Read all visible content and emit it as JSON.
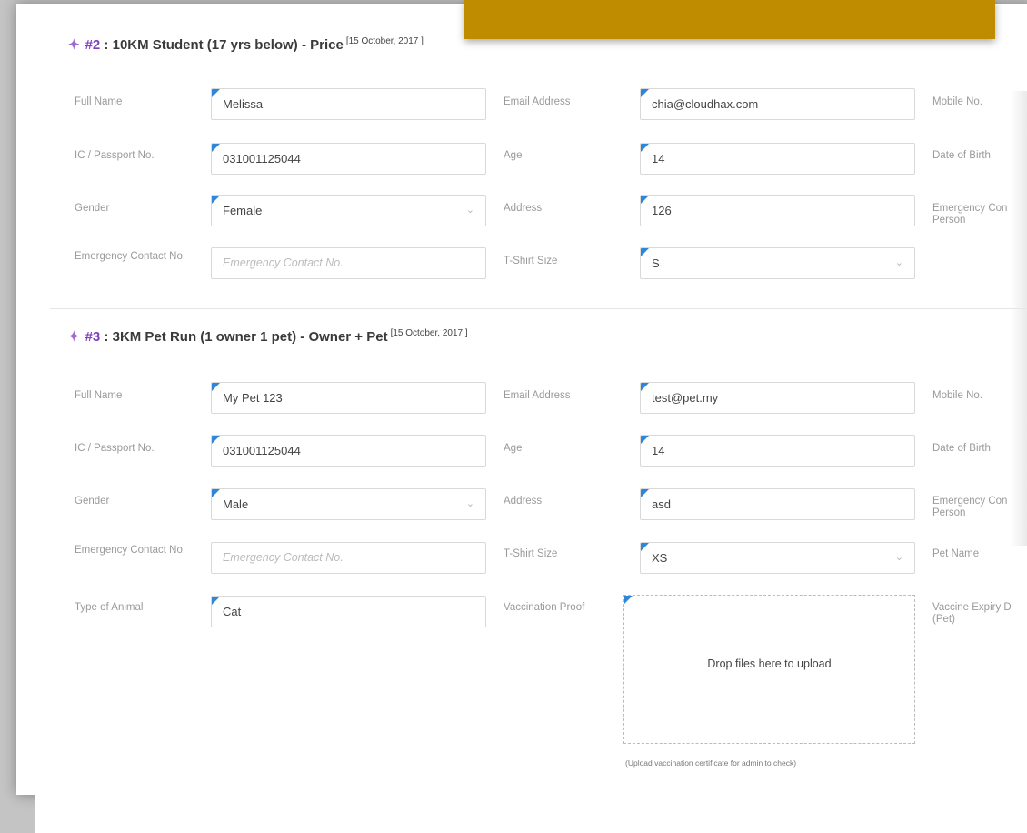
{
  "sections": [
    {
      "num": "#2",
      "title": " : 10KM Student (17 yrs below) - Price",
      "date": "[15 October, 2017 ]",
      "fields": {
        "full_name": {
          "label": "Full Name",
          "value": "Melissa"
        },
        "email": {
          "label": "Email Address",
          "value": "chia@cloudhax.com"
        },
        "mobile": {
          "label": "Mobile No."
        },
        "ic": {
          "label": "IC / Passport No.",
          "value": "031001125044"
        },
        "age": {
          "label": "Age",
          "value": "14"
        },
        "dob": {
          "label": "Date of Birth"
        },
        "gender": {
          "label": "Gender",
          "value": "Female"
        },
        "address": {
          "label": "Address",
          "value": "126"
        },
        "emergency_person": {
          "label": "Emergency Con Person"
        },
        "emergency_no": {
          "label": "Emergency Contact No.",
          "placeholder": "Emergency Contact No."
        },
        "tshirt": {
          "label": "T-Shirt Size",
          "value": "S"
        }
      }
    },
    {
      "num": "#3",
      "title": " : 3KM Pet Run (1 owner 1 pet) - Owner + Pet",
      "date": "[15 October, 2017 ]",
      "fields": {
        "full_name": {
          "label": "Full Name",
          "value": "My Pet 123"
        },
        "email": {
          "label": "Email Address",
          "value": "test@pet.my"
        },
        "mobile": {
          "label": "Mobile No."
        },
        "ic": {
          "label": "IC / Passport No.",
          "value": "031001125044"
        },
        "age": {
          "label": "Age",
          "value": "14"
        },
        "dob": {
          "label": "Date of Birth"
        },
        "gender": {
          "label": "Gender",
          "value": "Male"
        },
        "address": {
          "label": "Address",
          "value": "asd"
        },
        "emergency_person": {
          "label": "Emergency Con Person"
        },
        "emergency_no": {
          "label": "Emergency Contact No.",
          "placeholder": "Emergency Contact No."
        },
        "tshirt": {
          "label": "T-Shirt Size",
          "value": "XS"
        },
        "pet_name": {
          "label": "Pet Name"
        },
        "animal": {
          "label": "Type of Animal",
          "value": "Cat"
        },
        "vaccination": {
          "label": "Vaccination Proof",
          "drop_text": "Drop files here to upload",
          "hint": "(Upload vaccination certificate for admin to check)"
        },
        "vaccine_expiry": {
          "label": "Vaccine Expiry D (Pet)"
        }
      }
    }
  ],
  "icons": {
    "section": "tag-icon",
    "select": "chevron-down-icon"
  },
  "colors": {
    "accent": "#7e3fc0",
    "banner": "#bf8c00",
    "field_marker": "#2d86d8"
  }
}
